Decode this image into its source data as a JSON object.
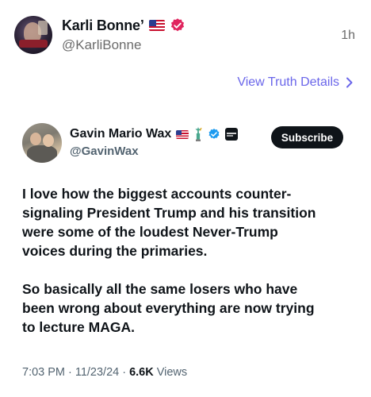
{
  "post": {
    "display_name": "Karli Bonne’",
    "handle": "@KarliBonne",
    "time": "1h",
    "flag_icon": "us-flag-icon",
    "verified_icon": "verified-badge-icon",
    "verified_color": "#e0245e"
  },
  "details_link": {
    "label": "View Truth Details",
    "color": "#6a66ea"
  },
  "quoted": {
    "display_name": "Gavin Mario Wax",
    "handle": "@GavinWax",
    "subscribe_label": "Subscribe",
    "verified_color": "#1d9bf0",
    "body": [
      "I love how the biggest accounts counter-\nsignaling President Trump and his transition\nwere some of the loudest Never-Trump\nvoices during the primaries.",
      "So basically all the same losers who have\nbeen wrong about everything are now trying\nto lecture MAGA."
    ],
    "time": "7:03 PM",
    "date": "11/23/24",
    "views_count": "6.6K",
    "views_label": "Views"
  }
}
